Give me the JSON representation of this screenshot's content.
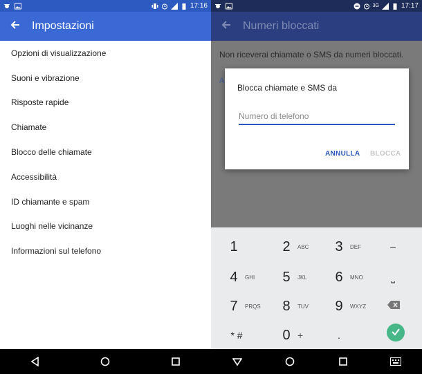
{
  "left": {
    "status_time": "17:16",
    "title": "Impostazioni",
    "items": [
      {
        "label": "Opzioni di visualizzazione"
      },
      {
        "label": "Suoni e vibrazione"
      },
      {
        "label": "Risposte rapide"
      },
      {
        "label": "Chiamate"
      },
      {
        "label": "Blocco delle chiamate"
      },
      {
        "label": "Accessibilità"
      },
      {
        "label": "ID chiamante e spam"
      },
      {
        "label": "Luoghi nelle vicinanze"
      },
      {
        "label": "Informazioni sul telefono"
      }
    ]
  },
  "right": {
    "status_time": "17:17",
    "network": "3G",
    "title": "Numeri bloccati",
    "description": "Non riceverai chiamate o SMS da numeri bloccati.",
    "add_link_partial": "A",
    "dialog": {
      "title": "Blocca chiamate e SMS da",
      "placeholder": "Numero di telefono",
      "cancel": "ANNULLA",
      "block": "BLOCCA"
    },
    "keypad": [
      {
        "digit": "1",
        "letters": ""
      },
      {
        "digit": "2",
        "letters": "ABC"
      },
      {
        "digit": "3",
        "letters": "DEF"
      },
      {
        "digit": "4",
        "letters": "GHI"
      },
      {
        "digit": "5",
        "letters": "JKL"
      },
      {
        "digit": "6",
        "letters": "MNO"
      },
      {
        "digit": "7",
        "letters": "PRQS"
      },
      {
        "digit": "8",
        "letters": "TUV"
      },
      {
        "digit": "9",
        "letters": "WXYZ"
      },
      {
        "digit": "* #",
        "letters": ""
      },
      {
        "digit": "0",
        "letters": "+"
      },
      {
        "digit": ".",
        "letters": ""
      }
    ],
    "keypad_side": {
      "top": "–",
      "middle": "⎵",
      "bottom_icon": "backspace-icon",
      "action_icon": "check-icon"
    }
  },
  "colors": {
    "left_appbar": "#3a69d6",
    "right_appbar_dim": "#2a3e80",
    "dialog_accent": "#2c55c4",
    "fab": "#47b788"
  }
}
